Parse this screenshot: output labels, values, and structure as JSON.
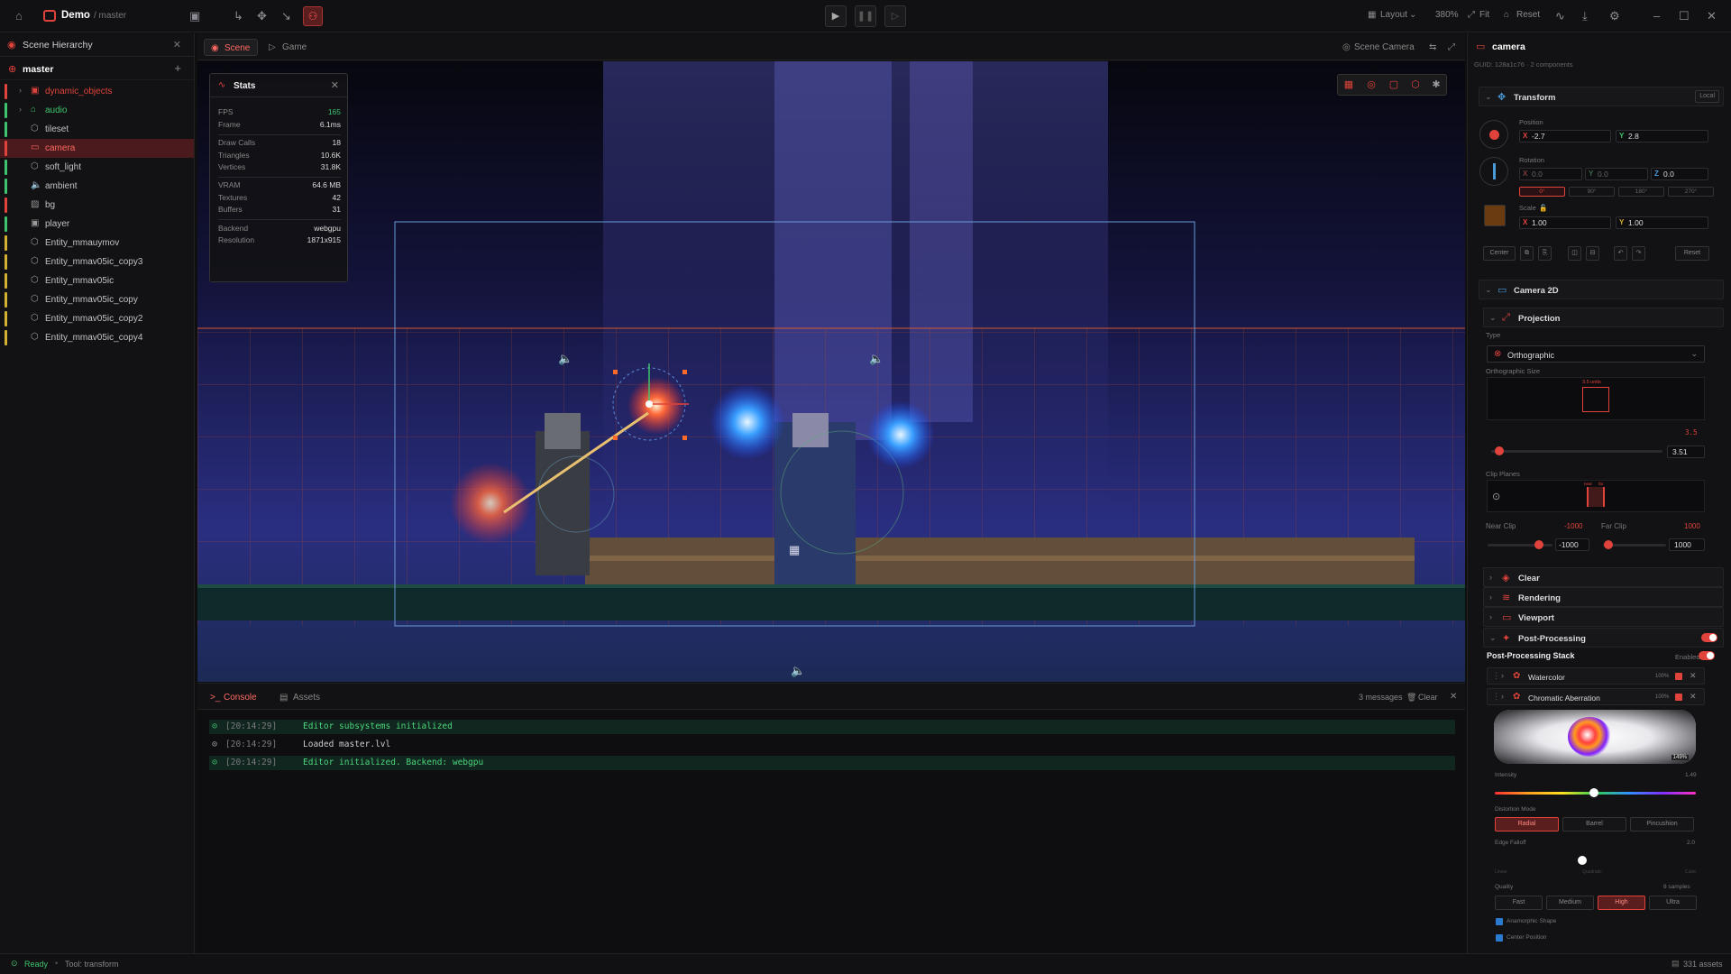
{
  "topbar": {
    "project": "Demo",
    "branch": "/ master",
    "layout_label": "Layout",
    "zoom": "380%",
    "fit_label": "Fit",
    "reset_label": "Reset"
  },
  "hierarchy": {
    "title": "Scene Hierarchy",
    "root": "master",
    "items": [
      {
        "label": "dynamic_objects",
        "color": "#e0433b",
        "bar": "#e0433b",
        "expandable": true
      },
      {
        "label": "audio",
        "color": "#3ec46d",
        "bar": "#3ec46d",
        "expandable": true
      },
      {
        "label": "tileset",
        "color": "#c2c2c6",
        "bar": "#3ec46d"
      },
      {
        "label": "camera",
        "color": "#ff6b63",
        "bar": "#e0433b",
        "selected": true
      },
      {
        "label": "soft_light",
        "color": "#c2c2c6",
        "bar": "#3ec46d"
      },
      {
        "label": "ambient",
        "color": "#c2c2c6",
        "bar": "#3ec46d"
      },
      {
        "label": "bg",
        "color": "#c2c2c6",
        "bar": "#e0433b"
      },
      {
        "label": "player",
        "color": "#c2c2c6",
        "bar": "#3ec46d"
      },
      {
        "label": "Entity_mmauymov",
        "color": "#c2c2c6",
        "bar": "#d4b030"
      },
      {
        "label": "Entity_mmav05ic_copy3",
        "color": "#c2c2c6",
        "bar": "#d4b030"
      },
      {
        "label": "Entity_mmav05ic",
        "color": "#c2c2c6",
        "bar": "#d4b030"
      },
      {
        "label": "Entity_mmav05ic_copy",
        "color": "#c2c2c6",
        "bar": "#d4b030"
      },
      {
        "label": "Entity_mmav05ic_copy2",
        "color": "#c2c2c6",
        "bar": "#d4b030"
      },
      {
        "label": "Entity_mmav05ic_copy4",
        "color": "#c2c2c6",
        "bar": "#d4b030"
      }
    ]
  },
  "viewport": {
    "tab_scene": "Scene",
    "tab_game": "Game",
    "camera_label": "Scene Camera"
  },
  "stats": {
    "title": "Stats",
    "fps_label": "FPS",
    "fps": "165",
    "frame_label": "Frame",
    "frame": "6.1ms",
    "drawcalls_label": "Draw Calls",
    "drawcalls": "18",
    "triangles_label": "Triangles",
    "triangles": "10.6K",
    "vertices_label": "Vertices",
    "vertices": "31.8K",
    "vram_label": "VRAM",
    "vram": "64.6 MB",
    "textures_label": "Textures",
    "textures": "42",
    "buffers_label": "Buffers",
    "buffers": "31",
    "backend_label": "Backend",
    "backend": "webgpu",
    "resolution_label": "Resolution",
    "resolution": "1871x915"
  },
  "console": {
    "tab_console": "Console",
    "tab_assets": "Assets",
    "count": "3 messages",
    "clear_label": "Clear",
    "logs": [
      {
        "time": "[20:14:29]",
        "msg": "Editor subsystems initialized",
        "kind": "ok"
      },
      {
        "time": "[20:14:29]",
        "msg": "Loaded master.lvl",
        "kind": "info"
      },
      {
        "time": "[20:14:29]",
        "msg": "Editor initialized. Backend: webgpu",
        "kind": "ok"
      }
    ]
  },
  "inspector": {
    "title": "camera",
    "subtitle": "GUID: 128a1c76 · 2 components",
    "transform": {
      "title": "Transform",
      "local_label": "Local",
      "position_label": "Position",
      "pos_x": "-2.7",
      "pos_y": "2.8",
      "rotation_label": "Rotation",
      "rot_x": "0.0",
      "rot_y": "0.0",
      "rot_z": "0.0",
      "angles": [
        "0°",
        "90°",
        "180°",
        "270°"
      ],
      "scale_label": "Scale",
      "scale_x": "1.00",
      "scale_y": "1.00",
      "center_label": "Center",
      "reset_label": "Reset"
    },
    "camera2d": {
      "title": "Camera 2D",
      "projection_title": "Projection",
      "type_label": "Type",
      "type_value": "Orthographic",
      "ortho_size_label": "Orthographic Size",
      "ortho_units": "3.5 units",
      "ortho_readout": "3.5",
      "ortho_value": "3.51",
      "ortho_fraction": 0.03,
      "clip_planes_label": "Clip Planes",
      "clip_near_mark": "near",
      "clip_far_mark": "far",
      "near_clip_label": "Near Clip",
      "near_clip_readout": "-1000",
      "far_clip_label": "Far Clip",
      "far_clip_readout": "1000",
      "near_value": "-1000",
      "far_value": "1000",
      "clear_title": "Clear",
      "rendering_title": "Rendering",
      "viewport_title": "Viewport",
      "postproc_title": "Post-Processing"
    },
    "postproc": {
      "stack_label": "Post-Processing Stack",
      "enabled_label": "Enabled",
      "effects": [
        {
          "name": "Watercolor",
          "pct": "100%"
        },
        {
          "name": "Chromatic Aberration",
          "pct": "100%"
        }
      ],
      "preview_pct": "149%",
      "intensity_label": "Intensity",
      "intensity_value": "1.49",
      "distortion_label": "Distortion Mode",
      "modes": [
        "Radial",
        "Barrel",
        "Pincushion"
      ],
      "falloff_label": "Edge Falloff",
      "falloff_value": "2.0",
      "falloff_left": "Linear",
      "falloff_mid": "Quadratic",
      "falloff_right": "Cubic",
      "quality_label": "Quality",
      "quality_samples": "8 samples",
      "qualities": [
        "Fast",
        "Medium",
        "High",
        "Ultra"
      ],
      "anamorphic_label": "Anamorphic Shape",
      "center_pos_label": "Center Position"
    }
  },
  "statusbar": {
    "ready": "Ready",
    "tool": "Tool: transform",
    "assets": "331 assets"
  },
  "colors": {
    "accent": "#e0433b",
    "ok": "#3ec46d",
    "bg": "#0f0f10"
  }
}
